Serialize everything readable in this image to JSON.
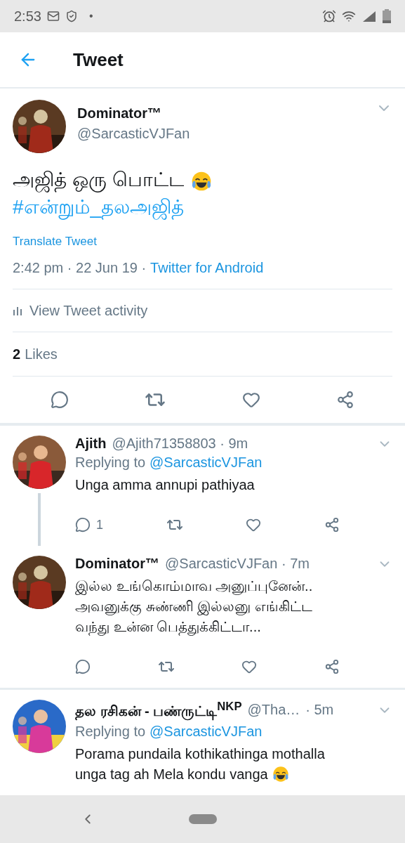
{
  "status_bar": {
    "time": "2:53",
    "dot": "•"
  },
  "header": {
    "title": "Tweet"
  },
  "tweet": {
    "name": "Dominator™",
    "handle": "@SarcasticVJFan",
    "text": "அஜித் ஒரு பொட்ட",
    "laugh_emoji": true,
    "hashtag": "#என்றும்_தலஅஜித்",
    "translate": "Translate Tweet",
    "time": "2:42 pm · 22 Jun 19 ·",
    "source": "Twitter for Android",
    "activity": "View Tweet activity",
    "likes_count": "2",
    "likes_label": "Likes"
  },
  "replies": [
    {
      "name": "Ajith",
      "handle": "@Ajith71358803 · 9m",
      "replying_prefix": "Replying to",
      "replying_handle": "@SarcasticVJFan",
      "body_lines": [
        "Unga amma annupi pathiyaa"
      ],
      "laugh_emoji": false,
      "reply_count": "1",
      "thread_connected": true
    },
    {
      "name": "Dominator™",
      "handle": "@SarcasticVJFan · 7m",
      "body_lines": [
        "இல்ல உங்கொம்மாவ அனுப்புனேன்..",
        "அவனுக்கு சுண்ணி இல்லனு எங்கிட்ட",
        "வந்து உன்ன பெத்துக்கிட்டா..."
      ],
      "laugh_emoji": false,
      "thread_connected": false
    },
    {
      "name": "தல ரசிகன் - பண்ருட்டி$^{NKP}$",
      "handle": "@Tha…",
      "time": "· 5m",
      "replying_prefix": "Replying to",
      "replying_handle": "@SarcasticVJFan",
      "body_lines": [
        "Porama pundaila kothikathinga mothalla",
        "unga tag ah Mela kondu vanga"
      ],
      "laugh_emoji": true,
      "thread_connected": false
    }
  ]
}
